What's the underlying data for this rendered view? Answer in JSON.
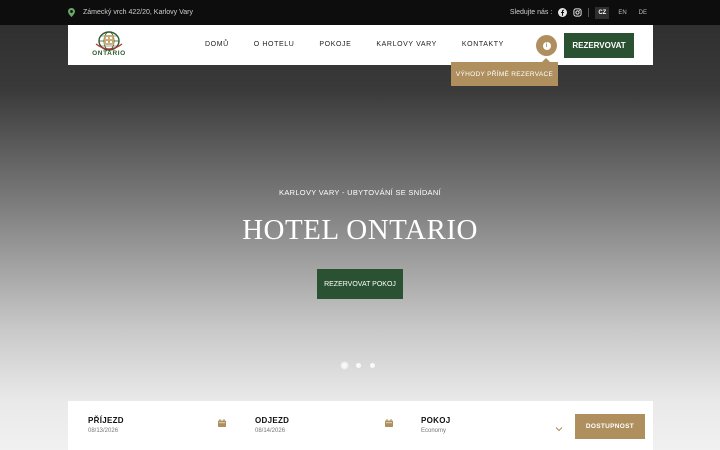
{
  "topbar": {
    "address": "Zámecký vrch 422/20, Karlovy Vary",
    "follow_label": "Sledujte nás :",
    "social_icons": [
      "facebook-icon",
      "instagram-icon"
    ],
    "languages": [
      "CZ",
      "EN",
      "DE"
    ],
    "active_language": "CZ"
  },
  "nav": {
    "logo_text": "ONTARIO",
    "items": [
      "DOMŮ",
      "O HOTELU",
      "POKOJE",
      "KARLOVY VARY",
      "KONTAKTY"
    ],
    "reserve_label": "REZERVOVAT",
    "tooltip": "VÝHODY PŘÍMÉ REZERVACE"
  },
  "hero": {
    "subtitle": "KARLOVY VARY - UBYTOVÁNÍ SE SNÍDANÍ",
    "title": "HOTEL ONTARIO",
    "button": "REZERVOVAT POKOJ",
    "slides": 3,
    "active_slide": 1
  },
  "booking": {
    "arrival_label": "PŘÍJEZD",
    "arrival_value": "08/13/2026",
    "departure_label": "ODJEZD",
    "departure_value": "08/14/2026",
    "room_label": "POKOJ",
    "room_value": "Economy",
    "submit": "DOSTUPNOST"
  },
  "colors": {
    "brand_green": "#2a5131",
    "accent_gold": "#b08f5f",
    "topbar_bg": "#0d0d0d"
  }
}
